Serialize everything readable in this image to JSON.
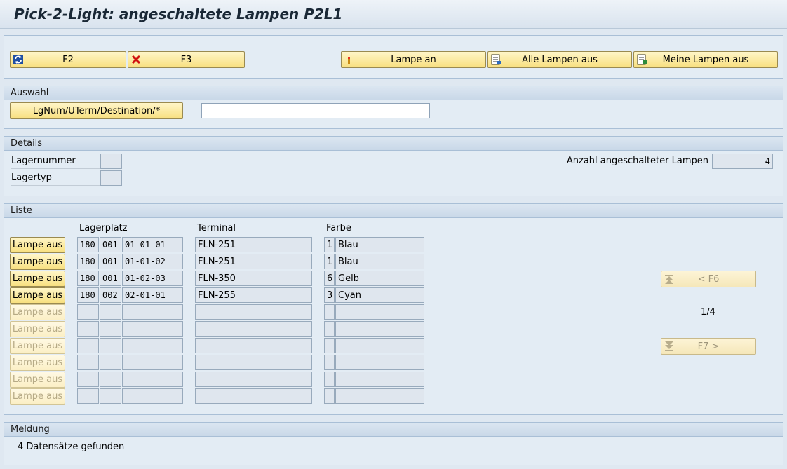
{
  "title": "Pick-2-Light: angeschaltete Lampen P2L1",
  "toolbar": {
    "f2_label": "F2",
    "f3_label": "F3",
    "lampe_an_label": "Lampe an",
    "alle_lampen_aus_label": "Alle Lampen aus",
    "meine_lampen_aus_label": "Meine Lampen aus"
  },
  "auswahl": {
    "header": "Auswahl",
    "button_label": "LgNum/UTerm/Destination/*",
    "input_value": ""
  },
  "details": {
    "header": "Details",
    "lagernummer_label": "Lagernummer",
    "lagernummer_value": "",
    "lagertyp_label": "Lagertyp",
    "lagertyp_value": "",
    "anzahl_label": "Anzahl angeschalteter Lampen",
    "anzahl_value": "4"
  },
  "liste": {
    "header": "Liste",
    "columns": {
      "lagerplatz": "Lagerplatz",
      "terminal": "Terminal",
      "farbe": "Farbe"
    },
    "row_button_label": "Lampe aus",
    "rows": [
      {
        "lgnum": "180",
        "lgtyp": "001",
        "platz": "01-01-01",
        "terminal": "FLN-251",
        "farbcode": "1",
        "farbe": "Blau",
        "enabled": true
      },
      {
        "lgnum": "180",
        "lgtyp": "001",
        "platz": "01-01-02",
        "terminal": "FLN-251",
        "farbcode": "1",
        "farbe": "Blau",
        "enabled": true
      },
      {
        "lgnum": "180",
        "lgtyp": "001",
        "platz": "01-02-03",
        "terminal": "FLN-350",
        "farbcode": "6",
        "farbe": "Gelb",
        "enabled": true
      },
      {
        "lgnum": "180",
        "lgtyp": "002",
        "platz": "02-01-01",
        "terminal": "FLN-255",
        "farbcode": "3",
        "farbe": "Cyan",
        "enabled": true
      },
      {
        "lgnum": "",
        "lgtyp": "",
        "platz": "",
        "terminal": "",
        "farbcode": "",
        "farbe": "",
        "enabled": false
      },
      {
        "lgnum": "",
        "lgtyp": "",
        "platz": "",
        "terminal": "",
        "farbcode": "",
        "farbe": "",
        "enabled": false
      },
      {
        "lgnum": "",
        "lgtyp": "",
        "platz": "",
        "terminal": "",
        "farbcode": "",
        "farbe": "",
        "enabled": false
      },
      {
        "lgnum": "",
        "lgtyp": "",
        "platz": "",
        "terminal": "",
        "farbcode": "",
        "farbe": "",
        "enabled": false
      },
      {
        "lgnum": "",
        "lgtyp": "",
        "platz": "",
        "terminal": "",
        "farbcode": "",
        "farbe": "",
        "enabled": false
      },
      {
        "lgnum": "",
        "lgtyp": "",
        "platz": "",
        "terminal": "",
        "farbcode": "",
        "farbe": "",
        "enabled": false
      }
    ],
    "prev_label": "< F6",
    "next_label": "F7 >",
    "page_indicator": "1/4"
  },
  "meldung": {
    "header": "Meldung",
    "text": "4 Datensätze gefunden"
  },
  "icons": {
    "f2": "refresh-icon",
    "f3": "cancel-x-icon",
    "lampe_an": "lamp-icon",
    "alle_lampen_aus": "document-list-icon",
    "meine_lampen_aus": "document-user-icon",
    "prev": "page-up-icon",
    "next": "page-down-icon"
  },
  "colors": {
    "button": "#f8e080",
    "panel_bg": "#e3ecf4",
    "panel_border": "#a9bfd6"
  }
}
